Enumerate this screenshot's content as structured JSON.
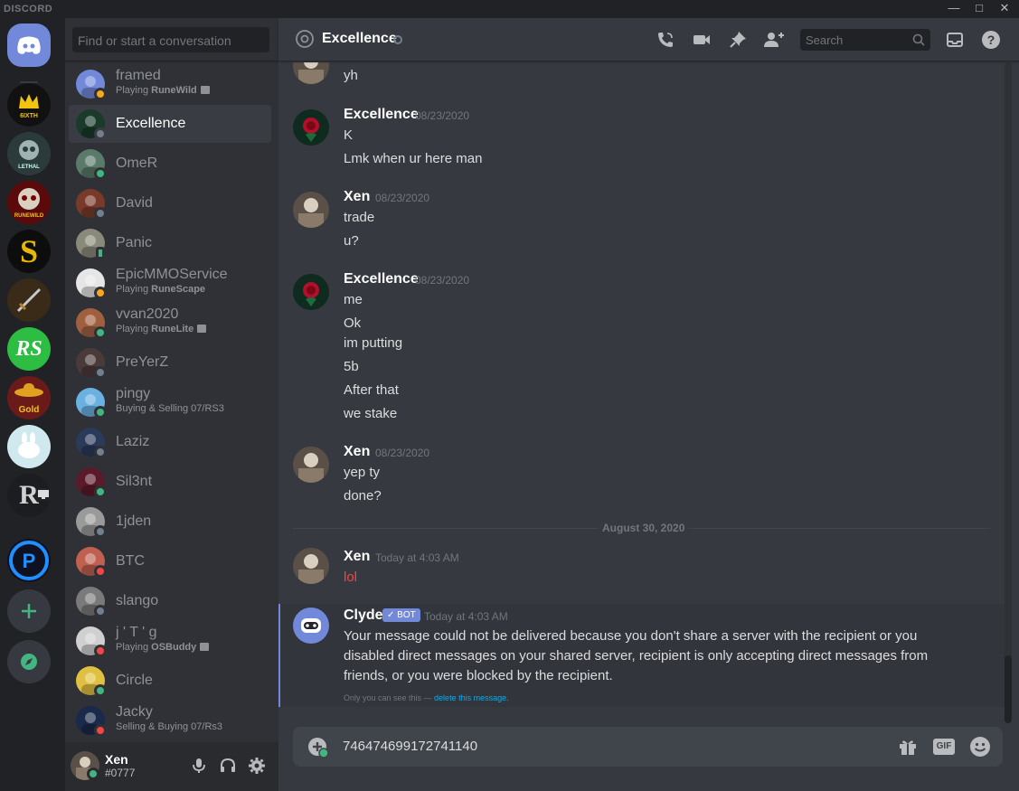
{
  "app": {
    "brand": "DISCORD",
    "window_controls": [
      "—",
      "□",
      "✕"
    ]
  },
  "guilds": [
    {
      "name": "Discord Home",
      "label": "",
      "color": "#7289da"
    },
    {
      "name": "6IXTH",
      "label": "6IXTH",
      "color": "#111111"
    },
    {
      "name": "LETHAL",
      "label": "LETHAL",
      "color": "#2b3b3b"
    },
    {
      "name": "RUNEWILD",
      "label": "RUNEWILD",
      "color": "#5a0a0a"
    },
    {
      "name": "S server",
      "label": "S",
      "color": "#0d0d0d"
    },
    {
      "name": "Sword server",
      "label": "",
      "color": "#3a2a18"
    },
    {
      "name": "RS",
      "label": "RS",
      "color": "#2dbd42"
    },
    {
      "name": "Tequila Gold",
      "label": "Gold",
      "color": "#6b1a1a"
    },
    {
      "name": "Bunny server",
      "label": "",
      "color": "#cfe9ef"
    },
    {
      "name": "R server",
      "label": "R",
      "color": "#1b1d20"
    },
    {
      "name": "P server",
      "label": "P",
      "color": "#0f1020"
    }
  ],
  "sidebar": {
    "search_placeholder": "Find or start a conversation",
    "dms": [
      {
        "name": "framed",
        "activity_prefix": "Playing ",
        "activity_game": "RuneWild",
        "status": "idle",
        "color": "#7289da",
        "rich": true
      },
      {
        "name": "Excellence",
        "activity_prefix": "",
        "activity_game": "",
        "status": "offline",
        "color": "#1a3a2a",
        "active": true
      },
      {
        "name": "OmeR",
        "activity_prefix": "",
        "activity_game": "",
        "status": "online",
        "color": "#5a7a6a"
      },
      {
        "name": "David",
        "activity_prefix": "",
        "activity_game": "",
        "status": "offline",
        "color": "#7a3a2a"
      },
      {
        "name": "Panic",
        "activity_prefix": "",
        "activity_game": "",
        "status": "mobile",
        "color": "#8a8a7a"
      },
      {
        "name": "EpicMMOService",
        "activity_prefix": "Playing ",
        "activity_game": "RuneScape",
        "status": "idle",
        "color": "#e6e6e6"
      },
      {
        "name": "vvan2020",
        "activity_prefix": "Playing ",
        "activity_game": "RuneLite",
        "status": "online",
        "color": "#a06040",
        "rich": true
      },
      {
        "name": "PreYerZ",
        "activity_prefix": "",
        "activity_game": "",
        "status": "offline",
        "color": "#4a3a3a"
      },
      {
        "name": "pingy",
        "activity_prefix": "",
        "activity_game": "Buying & Selling 07/RS3",
        "status": "online",
        "color": "#6ab0e0"
      },
      {
        "name": "Laziz",
        "activity_prefix": "",
        "activity_game": "",
        "status": "offline",
        "color": "#2a3a5a"
      },
      {
        "name": "Sil3nt",
        "activity_prefix": "",
        "activity_game": "",
        "status": "online",
        "color": "#5a1a2a"
      },
      {
        "name": "1jden",
        "activity_prefix": "",
        "activity_game": "",
        "status": "offline",
        "color": "#9a9a9a"
      },
      {
        "name": "BTC",
        "activity_prefix": "",
        "activity_game": "",
        "status": "dnd",
        "color": "#c06050"
      },
      {
        "name": "slango",
        "activity_prefix": "",
        "activity_game": "",
        "status": "offline",
        "color": "#7a7a7a"
      },
      {
        "name": "j ' T ' g",
        "activity_prefix": "Playing ",
        "activity_game": "OSBuddy",
        "status": "dnd",
        "color": "#d0d0d0",
        "rich": true
      },
      {
        "name": "Circle",
        "activity_prefix": "",
        "activity_game": "",
        "status": "online",
        "color": "#e0c040"
      },
      {
        "name": "Jacky",
        "activity_prefix": "",
        "activity_game": "Selling & Buying 07/Rs3",
        "status": "dnd",
        "color": "#1a2a4a"
      }
    ],
    "user": {
      "name": "Xen",
      "tag": "#0777",
      "status": "online"
    }
  },
  "header": {
    "title": "Excellence",
    "search_placeholder": "Search",
    "icons": [
      "call-icon",
      "video-icon",
      "pin-icon",
      "add-friend-icon",
      "inbox-icon",
      "help-icon"
    ]
  },
  "messages": {
    "partial_line": "yh",
    "groups": [
      {
        "author": "Excellence",
        "time": "08/23/2020",
        "lines": [
          "K",
          "Lmk when ur here man"
        ],
        "avatar": "rose"
      },
      {
        "author": "Xen",
        "time": "08/23/2020",
        "lines": [
          "trade",
          "u?"
        ],
        "avatar": "xen"
      },
      {
        "author": "Excellence",
        "time": "08/23/2020",
        "lines": [
          "me",
          "Ok",
          "im putting",
          "5b",
          "After that",
          "we stake"
        ],
        "avatar": "rose"
      },
      {
        "author": "Xen",
        "time": "08/23/2020",
        "lines": [
          "yep ty",
          "done?"
        ],
        "avatar": "xen"
      }
    ],
    "divider": "August 30, 2020",
    "today_group": {
      "author": "Xen",
      "time": "Today at 4:03 AM",
      "lines": [
        "lol"
      ],
      "line_color": "#f04747"
    },
    "clyde": {
      "author": "Clyde",
      "bot_tag": "✓ BOT",
      "time": "Today at 4:03 AM",
      "text": "Your message could not be delivered because you don't share a server with the recipient or you disabled direct messages on your shared server, recipient is only accepting direct messages from friends, or you were blocked by the recipient.",
      "ephemeral_prefix": "Only you can see this — ",
      "ephemeral_link": "delete this message."
    }
  },
  "composer": {
    "value": "746474699172741140",
    "gif_label": "GIF"
  },
  "colors": {
    "accent": "#7289da",
    "online": "#43b581",
    "idle": "#faa61a",
    "dnd": "#f04747",
    "offline": "#747f8d"
  }
}
